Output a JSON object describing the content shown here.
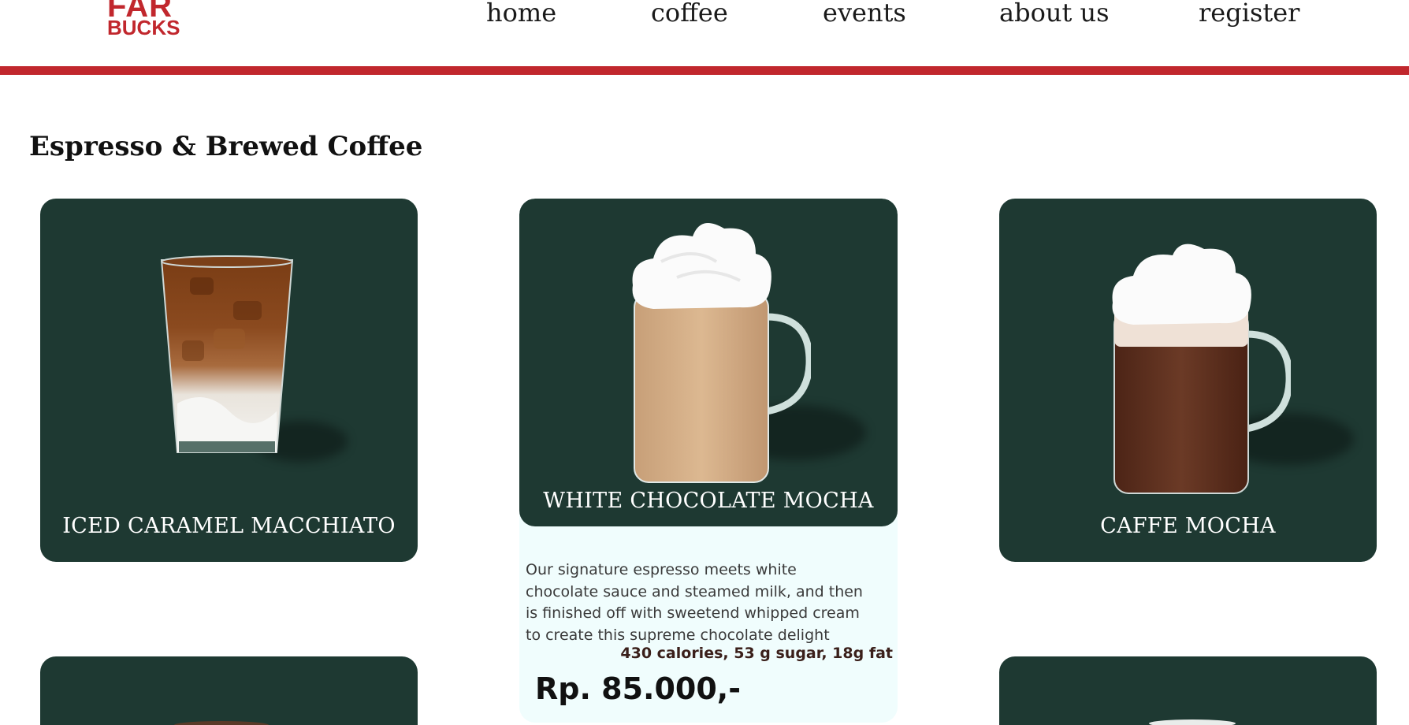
{
  "header": {
    "logo": {
      "line1": "FAR",
      "line2": "BUCKS"
    },
    "nav": [
      "home",
      "coffee",
      "events",
      "about us",
      "register"
    ]
  },
  "colors": {
    "brand_red": "#c1272d",
    "card_green": "#1e3932",
    "expanded_bg": "#f0fdfd"
  },
  "section": {
    "title": "Espresso & Brewed Coffee",
    "products": [
      {
        "name": "ICED CARAMEL MACCHIATO",
        "image_icon": "iced-caramel-macchiato-image"
      },
      {
        "name": "WHITE CHOCOLATE MOCHA",
        "image_icon": "white-chocolate-mocha-image",
        "description": "Our signature espresso meets white chocolate sauce and steamed milk, and then is finished off with sweetend whipped cream to create this supreme chocolate delight",
        "nutrition": "430 calories, 53 g sugar, 18g fat",
        "price": "Rp. 85.000,-"
      },
      {
        "name": "CAFFE MOCHA",
        "image_icon": "caffe-mocha-image"
      }
    ]
  }
}
